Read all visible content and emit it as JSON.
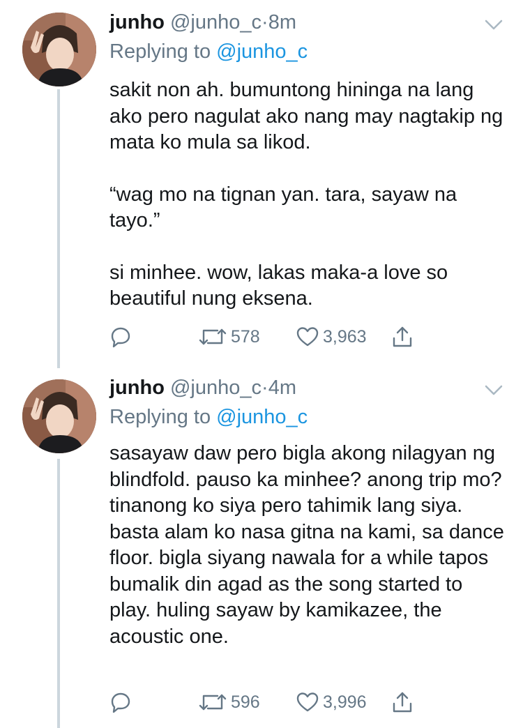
{
  "tweets": [
    {
      "name": "junho",
      "handle": "@junho_c",
      "separator": "·",
      "time": "8m",
      "replying_prefix": "Replying to",
      "replying_to": "@junho_c",
      "paragraphs": [
        "sakit non ah. bumuntong hininga na lang ako pero nagulat ako nang may nagtakip ng mata ko mula sa likod.",
        "“wag mo na tignan yan. tara, sayaw na tayo.”",
        "si minhee. wow, lakas maka-a love so beautiful nung eksena."
      ],
      "retweets": "578",
      "likes": "3,963"
    },
    {
      "name": "junho",
      "handle": "@junho_c",
      "separator": "·",
      "time": "4m",
      "replying_prefix": "Replying to",
      "replying_to": "@junho_c",
      "paragraphs": [
        "sasayaw daw pero bigla akong nilagyan ng blindfold. pauso ka minhee? anong trip mo? tinanong ko siya pero tahimik lang siya. basta alam ko nasa gitna na kami, sa dance floor. bigla siyang nawala for a while tapos bumalik din agad as the song started to play. huling sayaw by kamikazee, the acoustic one."
      ],
      "retweets": "596",
      "likes": "3,996"
    }
  ],
  "icons": {
    "reply": "reply-icon",
    "retweet": "retweet-icon",
    "like": "heart-icon",
    "share": "share-icon",
    "more": "chevron-down-icon"
  },
  "colors": {
    "text": "#14171a",
    "secondary": "#657786",
    "link": "#1b95e0",
    "thread_line": "#ccd6dd"
  }
}
